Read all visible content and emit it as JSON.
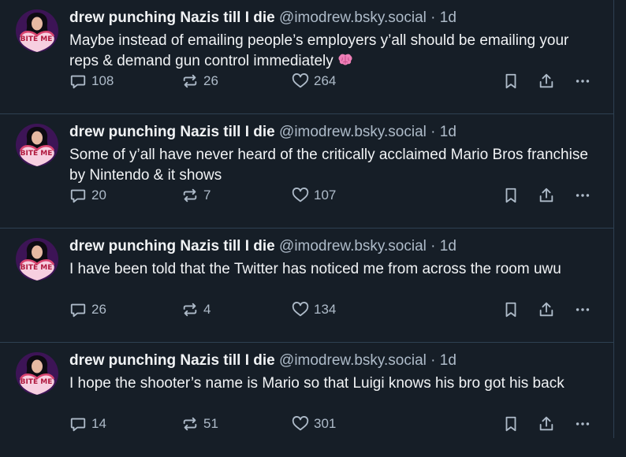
{
  "feed": {
    "posts": [
      {
        "author_name": "drew punching Nazis till I die",
        "handle": "@imodrew.bsky.social",
        "separator": " · ",
        "time": "1d",
        "text": "Maybe instead of emailing people’s employers y’all should be emailing your reps & demand gun control immediately",
        "emoji": "brain-emoji",
        "avatar_text": "BITE ME",
        "reply_count": "108",
        "repost_count": "26",
        "like_count": "264"
      },
      {
        "author_name": "drew punching Nazis till I die",
        "handle": "@imodrew.bsky.social",
        "separator": " · ",
        "time": "1d",
        "text": "Some of y’all have never heard of the critically acclaimed Mario Bros franchise by Nintendo & it shows",
        "avatar_text": "BITE ME",
        "reply_count": "20",
        "repost_count": "7",
        "like_count": "107"
      },
      {
        "author_name": "drew punching Nazis till I die",
        "handle": "@imodrew.bsky.social",
        "separator": " · ",
        "time": "1d",
        "text": "I have been told that the Twitter has noticed me from across the room uwu",
        "avatar_text": "BITE ME",
        "reply_count": "26",
        "repost_count": "4",
        "like_count": "134"
      },
      {
        "author_name": "drew punching Nazis till I die",
        "handle": "@imodrew.bsky.social",
        "separator": " · ",
        "time": "1d",
        "text": "I hope the shooter’s name is Mario so that Luigi knows his bro got his back",
        "avatar_text": "BITE ME",
        "reply_count": "14",
        "repost_count": "51",
        "like_count": "301"
      }
    ],
    "icons": {
      "reply": "reply-icon",
      "repost": "repost-icon",
      "like": "heart-icon",
      "bookmark": "bookmark-icon",
      "share": "share-icon",
      "more": "more-icon"
    },
    "colors": {
      "background": "#161e27",
      "text": "#f1f3f5",
      "muted": "#aebbc9",
      "divider": "#2e4052",
      "avatar_bg": "#3d1456",
      "emoji_pink": "#ee7fb7"
    }
  }
}
